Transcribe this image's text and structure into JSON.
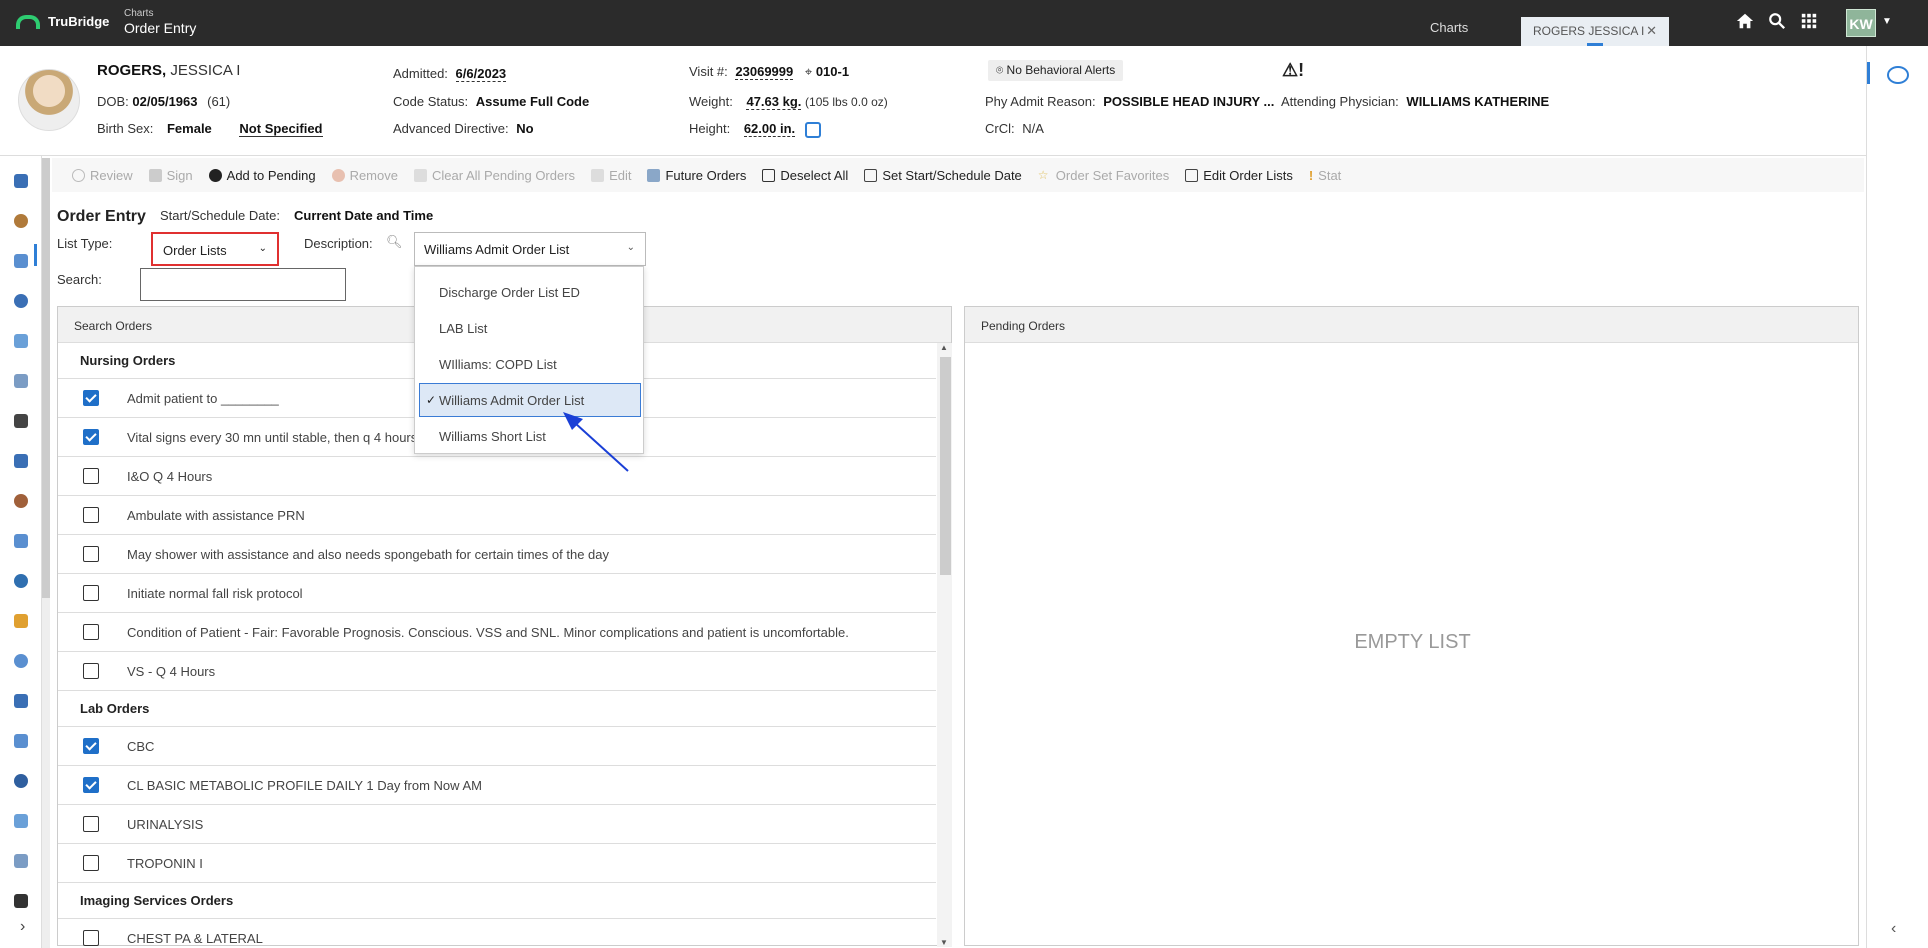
{
  "app": {
    "brand": "TruBridge",
    "breadcrumb_small": "Charts",
    "breadcrumb_title": "Order Entry"
  },
  "tabs": {
    "charts": "Charts",
    "patient": "ROGERS JESSICA I"
  },
  "user": {
    "initials": "KW"
  },
  "patient": {
    "last": "ROGERS,",
    "first": " JESSICA I",
    "dob_label": "DOB:",
    "dob": "02/05/1963",
    "age": "(61)",
    "sex_label": "Birth Sex:",
    "sex": "Female",
    "sex_extra": "Not Specified",
    "admitted_label": "Admitted:",
    "admitted": "6/6/2023",
    "code_label": "Code Status:",
    "code": "Assume Full Code",
    "adv_label": "Advanced Directive:",
    "adv": "No",
    "visit_label": "Visit #:",
    "visit": "23069999",
    "room": "010-1",
    "weight_label": "Weight:",
    "weight": "47.63 kg.",
    "weight_alt": "(105 lbs 0.0 oz)",
    "height_label": "Height:",
    "height": "62.00 in.",
    "alerts": "No Behavioral Alerts",
    "reason_label": "Phy Admit Reason:",
    "reason": "POSSIBLE HEAD INJURY ...",
    "crcl_label": "CrCl:",
    "crcl": "N/A",
    "attending_label": "Attending Physician:",
    "attending": "WILLIAMS KATHERINE"
  },
  "toolbar": {
    "review": "Review",
    "sign": "Sign",
    "add_pending": "Add to Pending",
    "remove": "Remove",
    "clear_pending": "Clear All Pending Orders",
    "edit": "Edit",
    "future": "Future Orders",
    "deselect": "Deselect All",
    "set_start": "Set Start/Schedule Date",
    "favorites": "Order Set Favorites",
    "edit_lists": "Edit Order Lists",
    "stat": "Stat"
  },
  "form": {
    "title": "Order Entry",
    "start_label": "Start/Schedule Date:",
    "start_value": "Current Date and Time",
    "list_type_label": "List Type:",
    "list_type_value": "Order Lists",
    "description_label": "Description:",
    "description_value": "Williams Admit Order List",
    "search_label": "Search:"
  },
  "dropdown": {
    "items": [
      "Discharge Order List ED",
      "LAB List",
      "WIlliams: COPD List",
      "Williams Admit Order List",
      "Williams Short List"
    ],
    "selected": "Williams Admit Order List",
    "check": "✓"
  },
  "search_panel": {
    "title": "Search Orders",
    "sections": [
      {
        "name": "Nursing Orders",
        "rows": [
          {
            "text": "Admit patient to ________",
            "checked": true
          },
          {
            "text": "Vital signs every 30 mn until stable, then q 4 hours",
            "checked": true
          },
          {
            "text": "I&O Q 4 Hours",
            "checked": false
          },
          {
            "text": "Ambulate with assistance PRN",
            "checked": false
          },
          {
            "text": "May shower with assistance and also needs spongebath for certain times of the day",
            "checked": false
          },
          {
            "text": "Initiate normal fall risk protocol",
            "checked": false
          },
          {
            "text": "Condition of Patient - Fair: Favorable Prognosis. Conscious. VSS and SNL. Minor complications and patient is uncomfortable.",
            "checked": false
          },
          {
            "text": "VS - Q 4 Hours",
            "checked": false
          }
        ]
      },
      {
        "name": "Lab Orders",
        "rows": [
          {
            "text": "CBC",
            "checked": true
          },
          {
            "text": "CL BASIC METABOLIC PROFILE DAILY 1 Day from Now AM",
            "checked": true
          },
          {
            "text": "URINALYSIS",
            "checked": false
          },
          {
            "text": "TROPONIN I",
            "checked": false
          }
        ]
      },
      {
        "name": "Imaging Services Orders",
        "rows": [
          {
            "text": "CHEST PA & LATERAL",
            "checked": false
          }
        ]
      }
    ]
  },
  "pending_panel": {
    "title": "Pending Orders",
    "empty_text": "EMPTY LIST"
  },
  "colors": {
    "topbar": "#2b2b2b",
    "accent": "#1f6fc8",
    "highlight_border": "#e03030",
    "arrow": "#1a3fd6"
  }
}
